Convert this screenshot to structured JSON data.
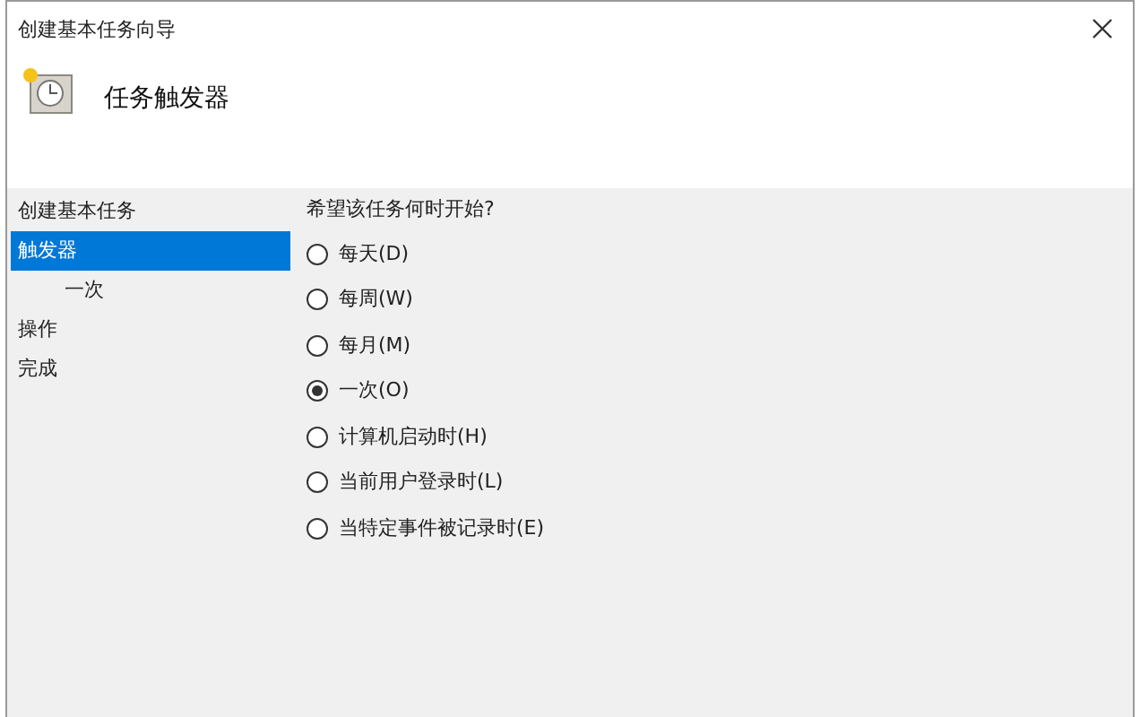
{
  "window": {
    "title": "创建基本任务向导"
  },
  "header": {
    "title": "任务触发器"
  },
  "nav": [
    {
      "label": "创建基本任务",
      "selected": false
    },
    {
      "label": "触发器",
      "selected": true,
      "children": [
        {
          "label": "一次",
          "selected": false
        }
      ]
    },
    {
      "label": "操作",
      "selected": false
    },
    {
      "label": "完成",
      "selected": false
    }
  ],
  "question": "希望该任务何时开始?",
  "options": [
    {
      "label": "每天(D)",
      "selected": false
    },
    {
      "label": "每周(W)",
      "selected": false
    },
    {
      "label": "每月(M)",
      "selected": false
    },
    {
      "label": "一次(O)",
      "selected": true
    },
    {
      "label": "计算机启动时(H)",
      "selected": false
    },
    {
      "label": "当前用户登录时(L)",
      "selected": false
    },
    {
      "label": "当特定事件被记录时(E)",
      "selected": false
    }
  ]
}
